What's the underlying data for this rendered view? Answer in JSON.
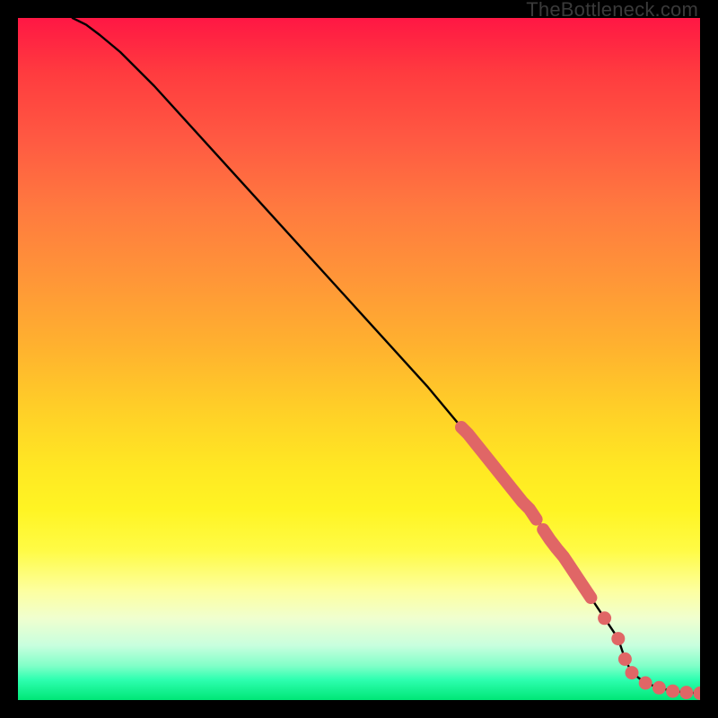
{
  "attribution": "TheBottleneck.com",
  "chart_data": {
    "type": "line",
    "title": "",
    "xlabel": "",
    "ylabel": "",
    "xlim": [
      0,
      100
    ],
    "ylim": [
      0,
      100
    ],
    "grid": false,
    "legend": false,
    "series": [
      {
        "name": "curve",
        "style": "line",
        "color": "#000000",
        "x": [
          8,
          10,
          12,
          15,
          20,
          30,
          40,
          50,
          60,
          65,
          70,
          75,
          80,
          84,
          86,
          88,
          89,
          90,
          92,
          94,
          96,
          98,
          100
        ],
        "y": [
          100,
          99,
          97.5,
          95,
          90,
          79,
          68,
          57,
          46,
          40,
          34,
          28,
          21,
          15,
          12,
          9,
          6,
          4,
          2.5,
          1.8,
          1.3,
          1.1,
          1.0
        ]
      },
      {
        "name": "highlight-segment-upper",
        "style": "thick-line",
        "color": "#e06666",
        "x": [
          65,
          66,
          68,
          70,
          72,
          74,
          75,
          76
        ],
        "y": [
          40,
          39,
          36.5,
          34,
          31.5,
          29,
          28,
          26.5
        ]
      },
      {
        "name": "highlight-segment-lower",
        "style": "thick-line",
        "color": "#e06666",
        "x": [
          77,
          78,
          79,
          80,
          81,
          82,
          83,
          84
        ],
        "y": [
          25,
          23.5,
          22.2,
          21,
          19.5,
          18,
          16.5,
          15
        ]
      },
      {
        "name": "bottom-points",
        "style": "scatter",
        "color": "#e06666",
        "x": [
          86,
          88,
          89,
          90,
          92,
          94,
          96,
          98,
          100
        ],
        "y": [
          12,
          9,
          6,
          4,
          2.5,
          1.8,
          1.3,
          1.1,
          1.0
        ]
      }
    ],
    "gradient_background": {
      "orientation": "vertical",
      "stops": [
        {
          "pos": 0.0,
          "color": "#ff1744"
        },
        {
          "pos": 0.5,
          "color": "#ffd127"
        },
        {
          "pos": 0.8,
          "color": "#fffb45"
        },
        {
          "pos": 1.0,
          "color": "#00e676"
        }
      ]
    }
  }
}
